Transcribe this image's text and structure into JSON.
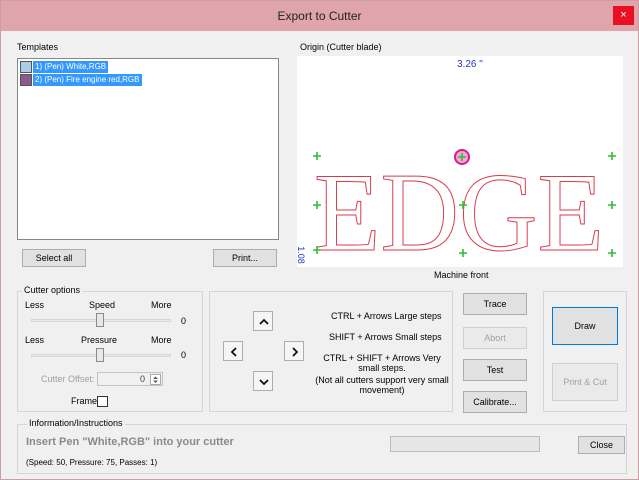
{
  "window": {
    "title": "Export to Cutter",
    "close_label": "×"
  },
  "templates": {
    "group_label": "Templates",
    "items": [
      {
        "label": "1) (Pen) White,RGB",
        "color": "#a9cce8"
      },
      {
        "label": "2) (Pen) Fire engine red,RGB",
        "color": "#8a5a8f"
      }
    ],
    "select_all_label": "Select all",
    "print_label": "Print..."
  },
  "origin": {
    "group_label": "Origin (Cutter blade)",
    "width_readout": "3.26 \"",
    "height_readout": "1.08",
    "design_text": "EDGE",
    "machine_front_label": "Machine front",
    "design_color": "#d93a4c",
    "marker_color": "#2fbf2f",
    "blade_color": "#d81b8c"
  },
  "cutter_options": {
    "group_label": "Cutter options",
    "speed": {
      "less": "Less",
      "label": "Speed",
      "more": "More",
      "value": "0"
    },
    "pressure": {
      "less": "Less",
      "label": "Pressure",
      "more": "More",
      "value": "0"
    },
    "offset_label": "Cutter Offset:",
    "offset_value": "0",
    "frame_label": "Frame"
  },
  "help": {
    "large_steps": "CTRL + Arrows  Large steps",
    "small_steps": "SHIFT + Arrows  Small steps",
    "very_small": "CTRL + SHIFT + Arrows  Very small steps.",
    "note": "(Not all cutters support very small movement)"
  },
  "actions": {
    "trace": "Trace",
    "abort": "Abort",
    "test": "Test",
    "calibrate": "Calibrate...",
    "draw": "Draw",
    "print_cut": "Print & Cut",
    "close": "Close"
  },
  "info": {
    "group_label": "Information/Instructions",
    "instruction": "Insert Pen \"White,RGB\" into your cutter",
    "details": "(Speed: 50, Pressure: 75, Passes: 1)"
  }
}
